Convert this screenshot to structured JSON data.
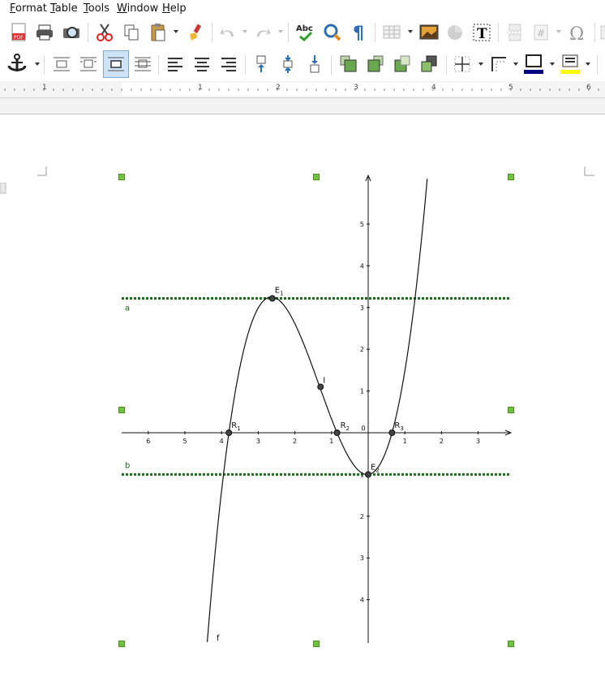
{
  "menu": [
    {
      "label": "Format",
      "mnemonic": "F",
      "rest": "ormat"
    },
    {
      "label": "Table",
      "mnemonic": "T",
      "rest": "able"
    },
    {
      "label": "Tools",
      "mnemonic": "T",
      "rest": "ools"
    },
    {
      "label": "Window",
      "mnemonic": "W",
      "rest": "indow"
    },
    {
      "label": "Help",
      "mnemonic": "H",
      "rest": "elp"
    }
  ],
  "toolbar_icons": {
    "abc_label": "Abc",
    "text_box_label": "T",
    "special_char_label": "Ω",
    "paragraph_label": "¶",
    "field_label": "#"
  },
  "colors": {
    "border_color": "#000080",
    "highlight_color": "#ffff00",
    "handle_color": "#76c043",
    "dotted_line_color": "#1a6b1a"
  },
  "ruler": {
    "numbers": [
      "1",
      "1",
      "2",
      "3",
      "4",
      "5",
      "6"
    ]
  },
  "graph": {
    "x_ticks_left": [
      "6",
      "5",
      "4",
      "3",
      "2",
      "1"
    ],
    "x_zero": "0",
    "x_ticks_right": [
      "1",
      "2",
      "3"
    ],
    "y_ticks_up": [
      "5",
      "4",
      "3",
      "2",
      "1"
    ],
    "y_ticks_down": [
      "1",
      "2",
      "3",
      "4"
    ],
    "line_a_label": "a",
    "line_b_label": "b",
    "curve_label": "f",
    "points": {
      "E1": {
        "label": "E",
        "sub": "1",
        "x": -2.615,
        "y": 3.22
      },
      "I": {
        "label": "I",
        "x": -1.3,
        "y": 1.1
      },
      "R1": {
        "label": "R",
        "sub": "1",
        "x": -3.8,
        "y": 0
      },
      "R2": {
        "label": "R",
        "sub": "2",
        "x": -0.85,
        "y": 0
      },
      "R3": {
        "label": "R",
        "sub": "3",
        "x": 0.65,
        "y": 0
      },
      "E2": {
        "label": "E",
        "sub": "2",
        "x": 0,
        "y": -1
      }
    },
    "line_a_y": 3.22,
    "line_b_y": -1
  }
}
